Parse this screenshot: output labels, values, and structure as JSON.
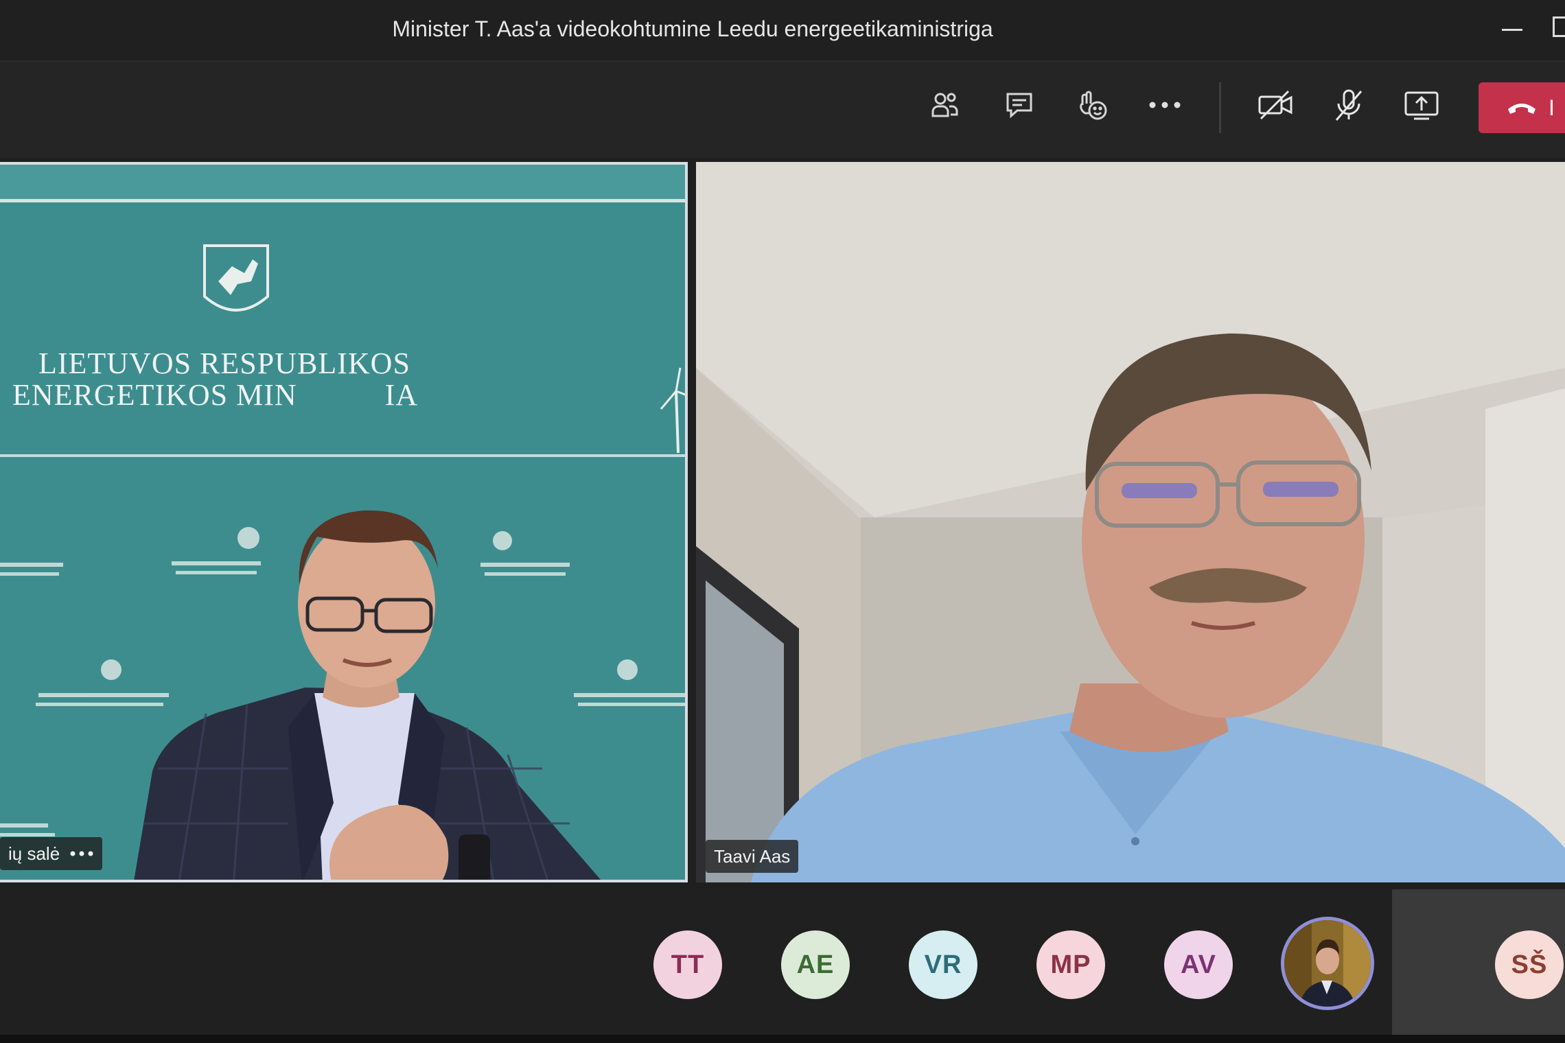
{
  "window": {
    "title": "Minister T. Aas'a videokohtumine Leedu energeetikaministriga"
  },
  "toolbar": {
    "leave_label": "I",
    "icons": [
      "participants-icon",
      "chat-icon",
      "reactions-icon",
      "more-icon",
      "camera-off-icon",
      "mic-off-icon",
      "share-screen-icon",
      "phone-hangup-icon"
    ]
  },
  "tiles": {
    "left": {
      "name": "ių salė",
      "wall_line1": "LIETUVOS RESPUBLIKOS",
      "wall_line2": "ENERGETIKOS MIN",
      "wall_line2_end": "IA"
    },
    "right": {
      "name": "Taavi Aas"
    }
  },
  "participants": [
    {
      "initials": "TT",
      "bg": "#f3d2e0",
      "fg": "#8a2d57"
    },
    {
      "initials": "AE",
      "bg": "#dcebd8",
      "fg": "#3d6b34"
    },
    {
      "initials": "VR",
      "bg": "#d6eef2",
      "fg": "#2d6d7a"
    },
    {
      "initials": "MP",
      "bg": "#f6d6dc",
      "fg": "#8a3343"
    },
    {
      "initials": "AV",
      "bg": "#f0d4ea",
      "fg": "#7d3373"
    },
    {
      "initials": "SŠ",
      "bg": "#f7dcd7",
      "fg": "#8b3e30"
    }
  ]
}
